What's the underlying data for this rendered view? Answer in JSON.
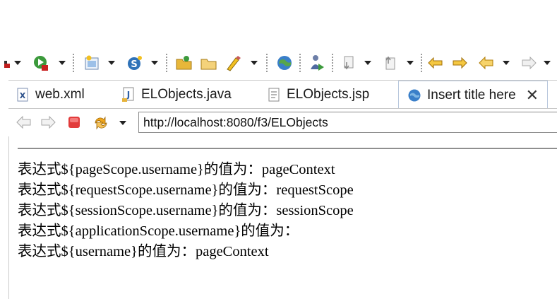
{
  "toolbar": {
    "icons": [
      "debug-icon",
      "run-icon",
      "new-wizard-icon",
      "new-class-icon",
      "open-type-icon",
      "open-folder-icon",
      "search-icon",
      "globe-icon",
      "person-run-icon",
      "next-annotation-icon",
      "previous-annotation-icon",
      "last-edit-icon",
      "forward-edit-icon",
      "back-icon",
      "forward-icon"
    ]
  },
  "tabs": [
    {
      "label": "web.xml",
      "icon": "xml-file-icon",
      "active": false
    },
    {
      "label": "ELObjects.java",
      "icon": "java-file-icon",
      "active": false
    },
    {
      "label": "ELObjects.jsp",
      "icon": "jsp-file-icon",
      "active": false
    },
    {
      "label": "Insert title here",
      "icon": "globe-icon",
      "active": true
    }
  ],
  "browser": {
    "url": "http://localhost:8080/f3/ELObjects",
    "buttons": [
      "back-icon",
      "forward-icon",
      "stop-icon",
      "refresh-icon"
    ]
  },
  "content": {
    "lines": [
      "表达式${pageScope.username}的值为：pageContext",
      "表达式${requestScope.username}的值为：requestScope",
      "表达式${sessionScope.username}的值为：sessionScope",
      "表达式${applicationScope.username}的值为：",
      "表达式${username}的值为：pageContext"
    ]
  },
  "colors": {
    "accent": "#2a6bb5",
    "stop": "#e23b3b",
    "arrow_orange": "#e39a10",
    "separator": "#9a9a9a"
  }
}
